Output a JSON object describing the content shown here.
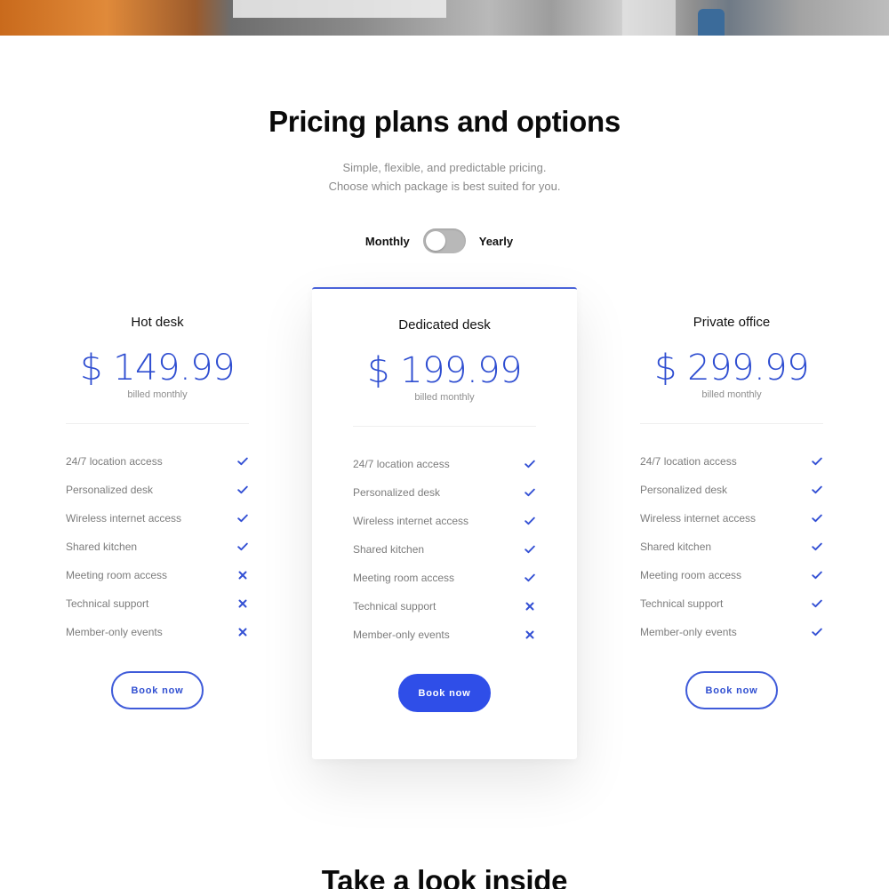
{
  "section": {
    "title": "Pricing plans and options",
    "subtitle_line1": "Simple, flexible, and predictable pricing.",
    "subtitle_line2": "Choose which package is best suited for you."
  },
  "toggle": {
    "left_label": "Monthly",
    "right_label": "Yearly",
    "state": "monthly"
  },
  "plans": [
    {
      "name": "Hot desk",
      "price": "$ 149.99",
      "billing": "billed monthly",
      "button_label": "Book now",
      "features": [
        {
          "label": "24/7 location access",
          "included": true
        },
        {
          "label": "Personalized desk",
          "included": true
        },
        {
          "label": "Wireless internet access",
          "included": true
        },
        {
          "label": "Shared kitchen",
          "included": true
        },
        {
          "label": "Meeting room access",
          "included": false
        },
        {
          "label": "Technical support",
          "included": false
        },
        {
          "label": "Member-only events",
          "included": false
        }
      ]
    },
    {
      "name": "Dedicated desk",
      "price": "$ 199.99",
      "billing": "billed monthly",
      "button_label": "Book now",
      "features": [
        {
          "label": "24/7 location access",
          "included": true
        },
        {
          "label": "Personalized desk",
          "included": true
        },
        {
          "label": "Wireless internet access",
          "included": true
        },
        {
          "label": "Shared kitchen",
          "included": true
        },
        {
          "label": "Meeting room access",
          "included": true
        },
        {
          "label": "Technical support",
          "included": false
        },
        {
          "label": "Member-only events",
          "included": false
        }
      ]
    },
    {
      "name": "Private office",
      "price": "$ 299.99",
      "billing": "billed monthly",
      "button_label": "Book now",
      "features": [
        {
          "label": "24/7 location access",
          "included": true
        },
        {
          "label": "Personalized desk",
          "included": true
        },
        {
          "label": "Wireless internet access",
          "included": true
        },
        {
          "label": "Shared kitchen",
          "included": true
        },
        {
          "label": "Meeting room access",
          "included": true
        },
        {
          "label": "Technical support",
          "included": true
        },
        {
          "label": "Member-only events",
          "included": true
        }
      ]
    }
  ],
  "next_section": {
    "title": "Take a look inside"
  },
  "colors": {
    "accent": "#2f4ee8",
    "price": "#2f4ed1",
    "muted_text": "#7c7c7c"
  },
  "icons": {
    "included": "check-icon",
    "excluded": "cross-icon"
  }
}
